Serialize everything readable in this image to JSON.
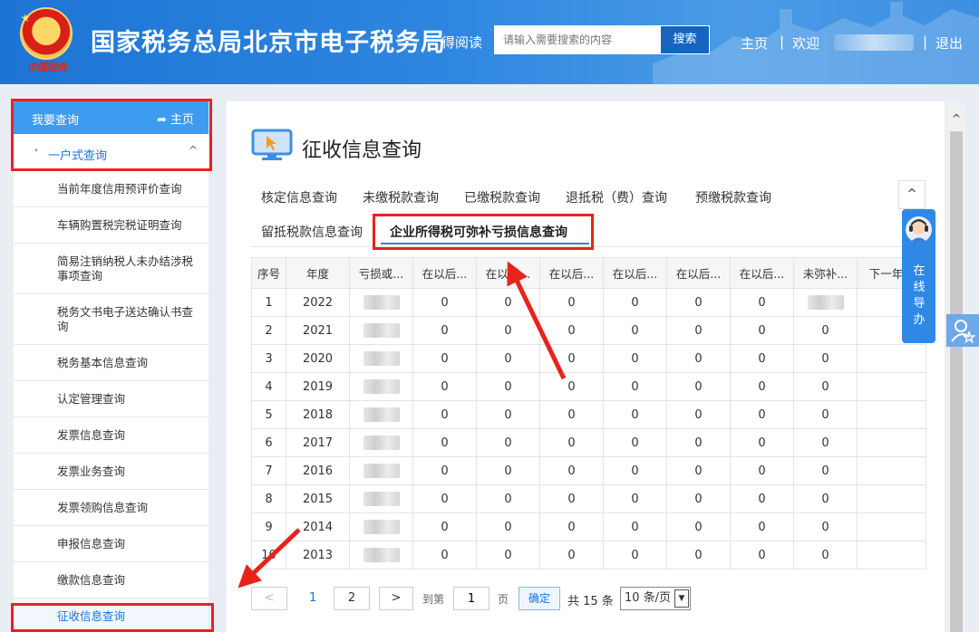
{
  "header": {
    "title": "国家税务总局北京市电子税务局",
    "read_link": "得阅读",
    "search_placeholder": "请输入需要搜索的内容",
    "search_button": "搜索",
    "nav_home": "主页",
    "nav_separator": "|",
    "nav_welcome": "欢迎",
    "nav_logout": "退出",
    "emblem_text": "中国税务"
  },
  "sidebar": {
    "title": "我要查询",
    "home_link": "主页",
    "group_bullet": "•",
    "group_label": "一户式查询",
    "group_chevron": "^",
    "items": [
      {
        "label": "当前年度信用预评价查询"
      },
      {
        "label": "车辆购置税完税证明查询"
      },
      {
        "label": "简易注销纳税人未办结涉税事项查询"
      },
      {
        "label": "税务文书电子送达确认书查询"
      },
      {
        "label": "税务基本信息查询"
      },
      {
        "label": "认定管理查询"
      },
      {
        "label": "发票信息查询"
      },
      {
        "label": "发票业务查询"
      },
      {
        "label": "发票领购信息查询"
      },
      {
        "label": "申报信息查询"
      },
      {
        "label": "缴款信息查询"
      },
      {
        "label": "征收信息查询"
      }
    ]
  },
  "main": {
    "page_title": "征收信息查询",
    "tabs": [
      {
        "label": "核定信息查询"
      },
      {
        "label": "未缴税款查询"
      },
      {
        "label": "已缴税款查询"
      },
      {
        "label": "退抵税（费）查询"
      },
      {
        "label": "预缴税款查询"
      },
      {
        "label": "留抵税款信息查询"
      },
      {
        "label": "企业所得税可弥补亏损信息查询"
      }
    ],
    "table": {
      "headers": [
        "序号",
        "年度",
        "亏损或...",
        "在以后...",
        "在以后...",
        "在以后...",
        "在以后...",
        "在以后...",
        "在以后...",
        "未弥补...",
        "下一年..."
      ],
      "rows": [
        {
          "no": "1",
          "year": "2022",
          "v1": "0",
          "v2": "0",
          "v3": "0",
          "v4": "0",
          "v5": "0",
          "v6": "0",
          "v7": ""
        },
        {
          "no": "2",
          "year": "2021",
          "v1": "0",
          "v2": "0",
          "v3": "0",
          "v4": "0",
          "v5": "0",
          "v6": "0",
          "v7": "0"
        },
        {
          "no": "3",
          "year": "2020",
          "v1": "0",
          "v2": "0",
          "v3": "0",
          "v4": "0",
          "v5": "0",
          "v6": "0",
          "v7": "0"
        },
        {
          "no": "4",
          "year": "2019",
          "v1": "0",
          "v2": "0",
          "v3": "0",
          "v4": "0",
          "v5": "0",
          "v6": "0",
          "v7": "0"
        },
        {
          "no": "5",
          "year": "2018",
          "v1": "0",
          "v2": "0",
          "v3": "0",
          "v4": "0",
          "v5": "0",
          "v6": "0",
          "v7": "0"
        },
        {
          "no": "6",
          "year": "2017",
          "v1": "0",
          "v2": "0",
          "v3": "0",
          "v4": "0",
          "v5": "0",
          "v6": "0",
          "v7": "0"
        },
        {
          "no": "7",
          "year": "2016",
          "v1": "0",
          "v2": "0",
          "v3": "0",
          "v4": "0",
          "v5": "0",
          "v6": "0",
          "v7": "0"
        },
        {
          "no": "8",
          "year": "2015",
          "v1": "0",
          "v2": "0",
          "v3": "0",
          "v4": "0",
          "v5": "0",
          "v6": "0",
          "v7": "0"
        },
        {
          "no": "9",
          "year": "2014",
          "v1": "0",
          "v2": "0",
          "v3": "0",
          "v4": "0",
          "v5": "0",
          "v6": "0",
          "v7": "0"
        },
        {
          "no": "10",
          "year": "2013",
          "v1": "0",
          "v2": "0",
          "v3": "0",
          "v4": "0",
          "v5": "0",
          "v6": "0",
          "v7": "0"
        }
      ]
    },
    "pager": {
      "prev": "<",
      "page1": "1",
      "page2": "2",
      "next": ">",
      "goto_label": "到第",
      "goto_value": "1",
      "page_unit": "页",
      "confirm": "确定",
      "total": "共 15 条",
      "page_size": "10 条/页"
    }
  },
  "widgets": {
    "back_to_top": "^",
    "online_help": "在线导办",
    "scroll_up": "^"
  },
  "colors": {
    "header_blue": "#1d74d4",
    "sidebar_head": "#3d9bf0",
    "link_blue": "#1a73d9",
    "annotation_red": "#e8231c"
  },
  "icons": [
    "home-icon",
    "chevron-up-icon",
    "monitor-cursor-icon",
    "customer-service-avatar-icon",
    "user-star-icon"
  ]
}
